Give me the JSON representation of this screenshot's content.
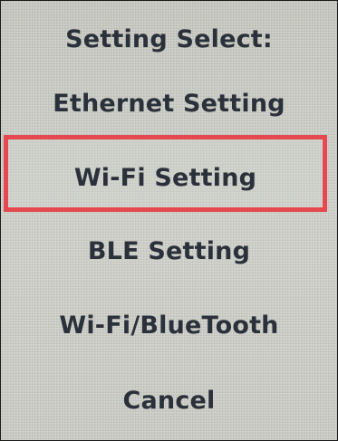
{
  "screen": {
    "title": "Setting Select:",
    "menu": [
      {
        "label": "Ethernet Setting",
        "selected": false
      },
      {
        "label": "Wi-Fi Setting",
        "selected": true
      },
      {
        "label": "BLE Setting",
        "selected": false
      },
      {
        "label": "Wi-Fi/BlueTooth",
        "selected": false
      },
      {
        "label": "Cancel",
        "selected": false
      }
    ],
    "highlight_color": "#e5484f",
    "text_color": "#2b313a",
    "screen_color": "#c8cac3"
  }
}
